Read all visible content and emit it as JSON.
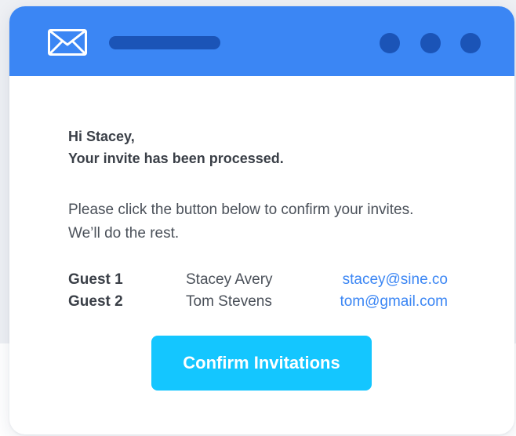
{
  "colors": {
    "titlebar": "#3b86f4",
    "titlebar_accent": "#1b54b7",
    "link": "#3b86f4",
    "button": "#14c6ff",
    "button_text": "#ffffff"
  },
  "titlebar": {
    "icon": "mail-icon",
    "window_controls": [
      "dot",
      "dot",
      "dot"
    ]
  },
  "email": {
    "greeting": "Hi Stacey,",
    "headline": "Your invite has been processed.",
    "message": "Please click the button below to confirm your invites. We’ll do the rest.",
    "guests": [
      {
        "label": "Guest 1",
        "name": "Stacey Avery",
        "email": "stacey@sine.co"
      },
      {
        "label": "Guest 2",
        "name": "Tom Stevens",
        "email": "tom@gmail.com"
      }
    ],
    "confirm_label": "Confirm Invitations"
  }
}
